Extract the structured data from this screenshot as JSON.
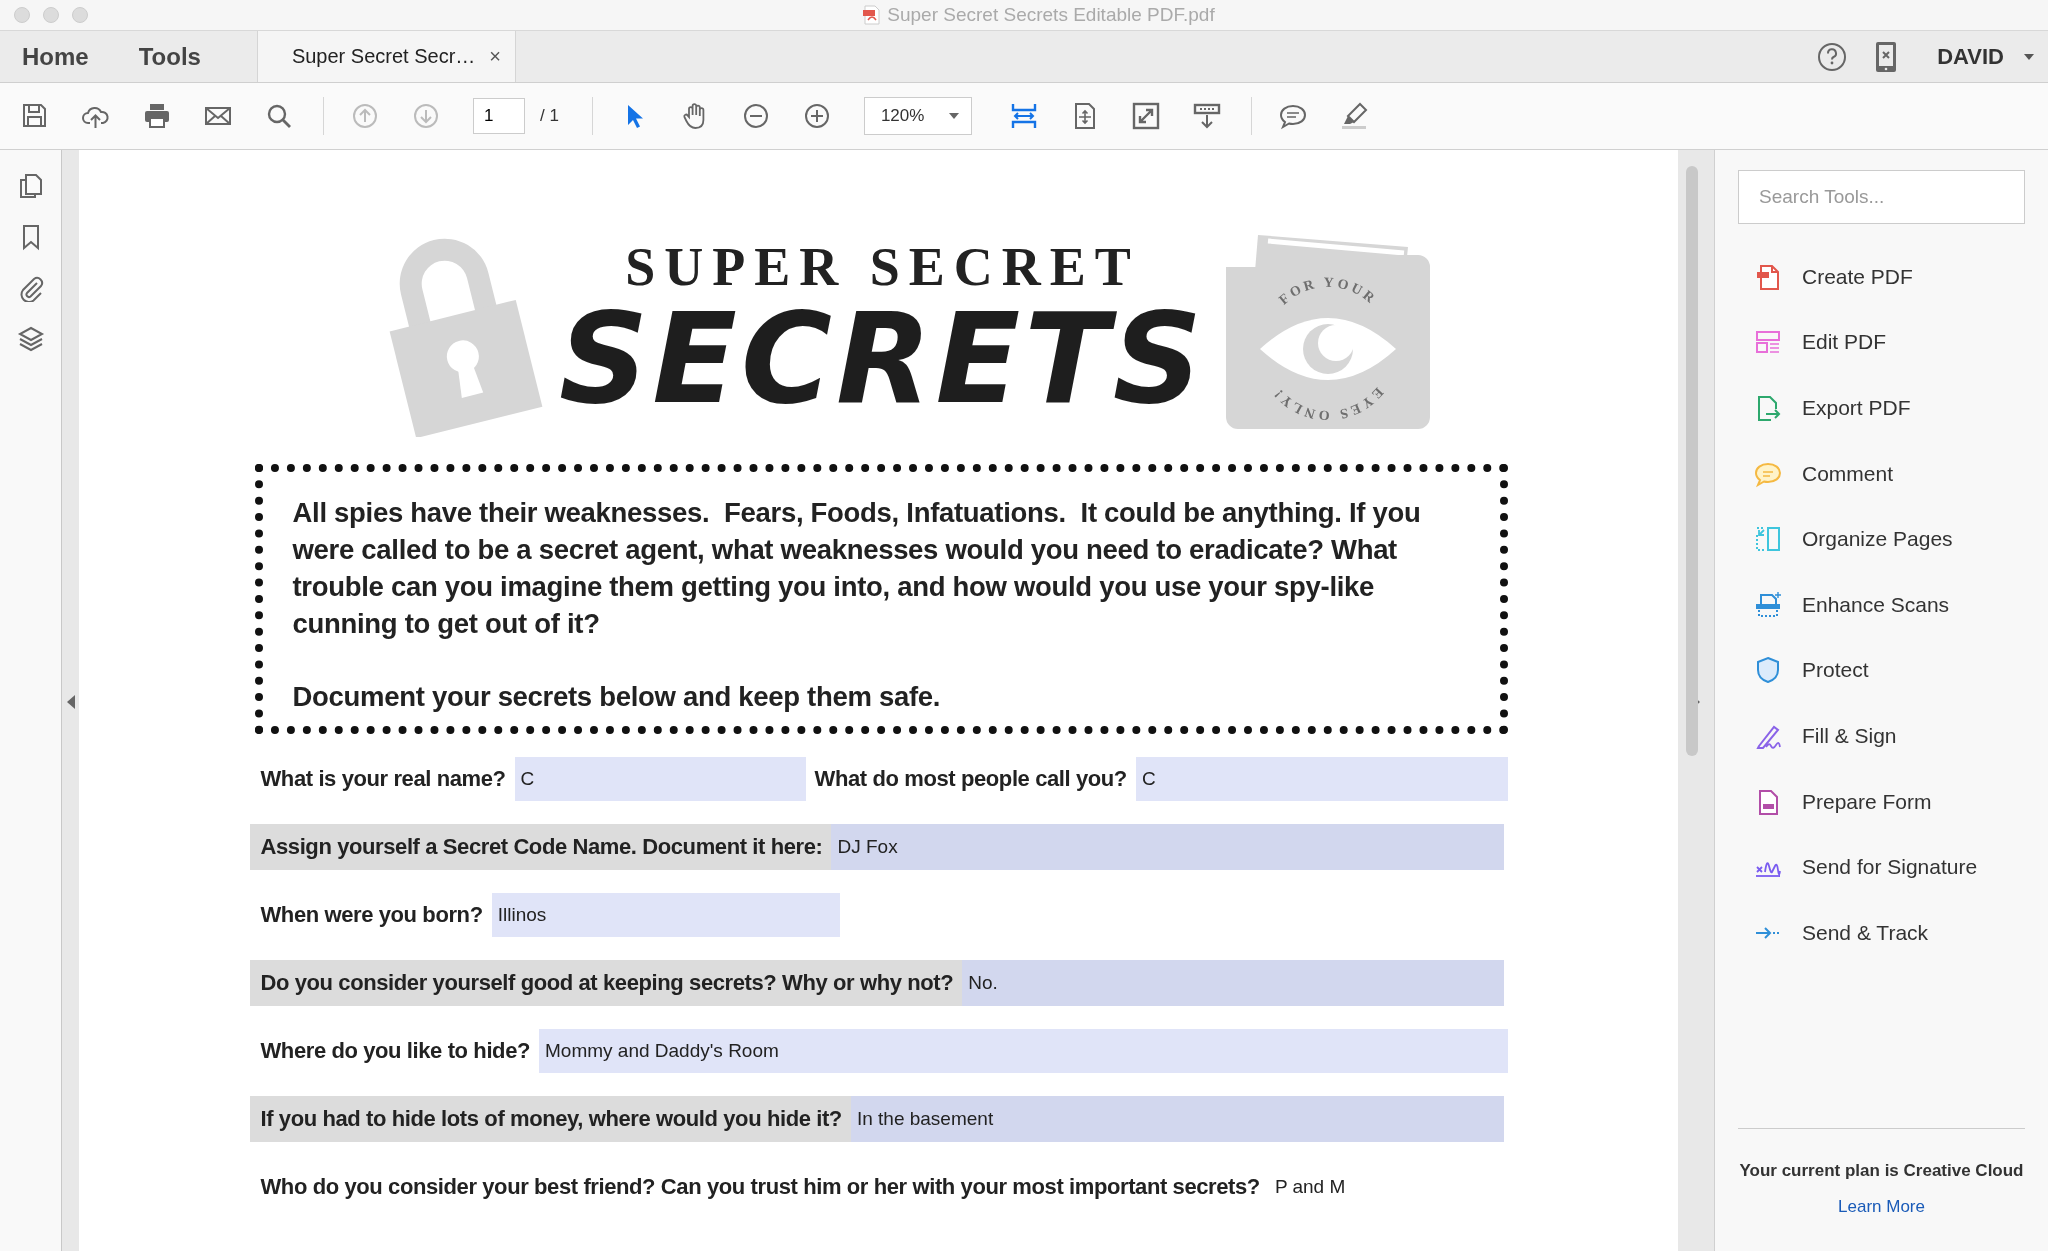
{
  "window": {
    "title": "Super Secret Secrets Editable PDF.pdf"
  },
  "tabs": [
    {
      "label": "Home",
      "selected": false
    },
    {
      "label": "Tools",
      "selected": false
    },
    {
      "label": "Super Secret Secr…",
      "selected": true,
      "close": "×"
    }
  ],
  "account": {
    "user": "DAVID"
  },
  "toolbar": {
    "items": [
      {
        "kind": "save",
        "active": false,
        "disabled": false
      },
      {
        "kind": "upload",
        "active": false,
        "disabled": false
      },
      {
        "kind": "print",
        "active": false,
        "disabled": false
      },
      {
        "kind": "mail",
        "active": false,
        "disabled": false
      },
      {
        "kind": "search",
        "active": false,
        "disabled": false
      },
      {
        "kind": "separator"
      },
      {
        "kind": "prev-page",
        "active": false,
        "disabled": true
      },
      {
        "kind": "next-page",
        "active": false,
        "disabled": true
      },
      {
        "kind": "page",
        "value": "1",
        "total": "/ 1"
      },
      {
        "kind": "separator"
      },
      {
        "kind": "select",
        "active": true,
        "disabled": false
      },
      {
        "kind": "hand",
        "active": false,
        "disabled": false
      },
      {
        "kind": "zoom-out",
        "active": false,
        "disabled": false
      },
      {
        "kind": "zoom-in",
        "active": false,
        "disabled": false
      },
      {
        "kind": "zoom",
        "value": "120%"
      },
      {
        "kind": "fit-width",
        "active": true,
        "disabled": false
      },
      {
        "kind": "rotate",
        "active": false,
        "disabled": false
      },
      {
        "kind": "full-screen",
        "active": false,
        "disabled": false
      },
      {
        "kind": "read-mode",
        "active": false,
        "disabled": false
      },
      {
        "kind": "separator"
      },
      {
        "kind": "comment",
        "active": false,
        "disabled": false
      },
      {
        "kind": "highlight",
        "active": false,
        "disabled": false
      }
    ]
  },
  "document": {
    "heading_top": "SUPER SECRET",
    "heading_main": "SECRETS",
    "badge_top": "FOR YOUR",
    "badge_bottom": "EYES ONLY!",
    "intro": "All spies have their weaknesses.  Fears, Foods, Infatuations.  It could be anything. If you were called to be a secret agent, what weaknesses would you need to eradicate? What trouble can you imagine them getting you into, and how would you use your spy-like cunning to get out of it?",
    "intro_closing": "Document your secrets below and keep them safe.",
    "rows": [
      {
        "shaded": false,
        "items": [
          {
            "question": "What is your real name?",
            "answer": "C",
            "kind": "field"
          },
          {
            "question": "What do most people call you?",
            "answer": "C",
            "kind": "field"
          }
        ]
      },
      {
        "shaded": true,
        "items": [
          {
            "question": "Assign yourself a Secret Code Name.  Document it here:",
            "answer": "DJ Fox",
            "kind": "field"
          }
        ]
      },
      {
        "shaded": false,
        "items": [
          {
            "question": "When were you born?",
            "answer": "Illinos",
            "kind": "field"
          }
        ]
      },
      {
        "shaded": true,
        "items": [
          {
            "question": "Do you consider yourself good at keeping secrets?  Why or why not?",
            "answer": "No.",
            "kind": "field"
          }
        ]
      },
      {
        "shaded": false,
        "items": [
          {
            "question": "Where do you like to hide?",
            "answer": "Mommy and Daddy's Room",
            "kind": "field"
          }
        ]
      },
      {
        "shaded": true,
        "items": [
          {
            "question": "If you had to hide lots of money, where would you hide it?",
            "answer": "In the basement",
            "kind": "field"
          }
        ]
      },
      {
        "shaded": false,
        "items": [
          {
            "question": "Who do you consider your best friend?  Can you trust him or her with your most important secrets?",
            "answer": "P and M",
            "kind": "plain"
          }
        ]
      }
    ]
  },
  "tools_panel": {
    "search": {
      "placeholder": "Search Tools..."
    },
    "items": [
      {
        "label": "Create PDF",
        "kind": "create"
      },
      {
        "label": "Edit PDF",
        "kind": "edit"
      },
      {
        "label": "Export PDF",
        "kind": "export"
      },
      {
        "label": "Comment",
        "kind": "comment"
      },
      {
        "label": "Organize Pages",
        "kind": "organize"
      },
      {
        "label": "Enhance Scans",
        "kind": "enhance"
      },
      {
        "label": "Protect",
        "kind": "protect"
      },
      {
        "label": "Fill & Sign",
        "kind": "fill-sign"
      },
      {
        "label": "Prepare Form",
        "kind": "prepare-form"
      },
      {
        "label": "Send for Signature",
        "kind": "send-signature"
      },
      {
        "label": "Send & Track",
        "kind": "send-track"
      }
    ],
    "plan": "Your current plan is Creative Cloud",
    "link": "Learn More"
  }
}
